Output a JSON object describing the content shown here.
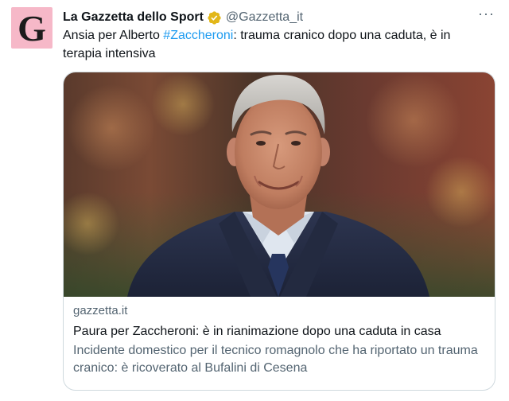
{
  "author": {
    "avatar_letter": "G",
    "display_name": "La Gazzetta dello Sport",
    "handle": "@Gazzetta_it",
    "verified_icon": "verified-badge-gold"
  },
  "menu": {
    "more_label": "···"
  },
  "tweet": {
    "text_before": "Ansia per Alberto ",
    "hashtag": "#Zaccheroni",
    "text_after": ": trauma cranico dopo una caduta, è in terapia intensiva"
  },
  "card": {
    "image_subject": "portrait photo of Alberto Zaccheroni",
    "domain": "gazzetta.it",
    "title": "Paura per Zaccheroni: è in rianimazione dopo una caduta in casa",
    "description": "Incidente domestico per il tecnico romagnolo che ha riportato un trauma cranico: è ricoverato al Bufalini di Cesena"
  },
  "colors": {
    "avatar_bg": "#f6b8c8",
    "link": "#1d9bf0",
    "verified": "#e2b719",
    "secondary_text": "#536471",
    "card_border": "#cfd9de"
  }
}
